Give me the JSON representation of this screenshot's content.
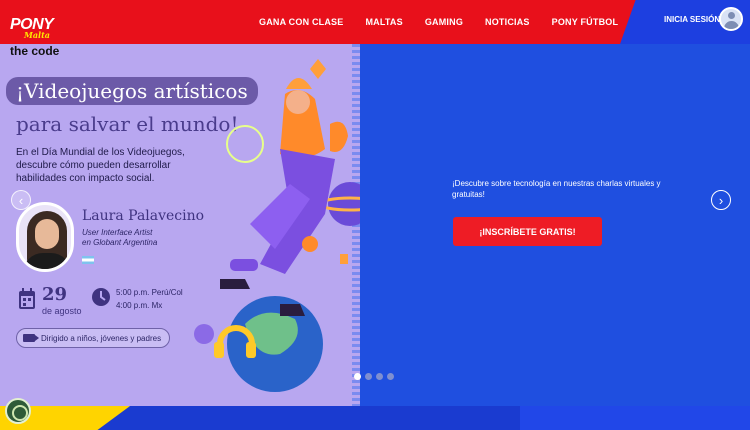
{
  "header": {
    "logo": {
      "text": "PONY",
      "sub": "Malta"
    },
    "nav": [
      "GANA CON CLASE",
      "MALTAS",
      "GAMING",
      "NOTICIAS",
      "PONY FÚTBOL"
    ],
    "login_label": "INICIA SESIÓN"
  },
  "banner": {
    "brand": "the code",
    "headline_1": "¡Videojuegos artísticos",
    "headline_2": "para salvar el mundo!",
    "description": "En el Día Mundial de los Videojuegos, descubre cómo pueden desarrollar habilidades con impacto social.",
    "speaker": {
      "name": "Laura Palavecino",
      "role_line1": "User Interface Artist",
      "role_line2": "en Globant Argentina"
    },
    "date": {
      "day": "29",
      "month": "de agosto"
    },
    "times": [
      "5:00 p.m. Perú/Col",
      "4:00 p.m. Mx"
    ],
    "audience": "Dirigido a niños, jóvenes y padres",
    "promo_text": "¡Descubre sobre tecnología en nuestras charlas virtuales y gratuitas!",
    "cta_label": "¡INSCRÍBETE GRATIS!",
    "slider": {
      "active_index": 0,
      "count": 4
    },
    "arrow_left": "‹",
    "arrow_right": "›"
  },
  "colors": {
    "header_red": "#e8101b",
    "banner_purple": "#b8a7f0",
    "banner_blue": "#1f4fe0",
    "cta_red": "#ee1c25",
    "footer_yellow": "#ffd400"
  }
}
